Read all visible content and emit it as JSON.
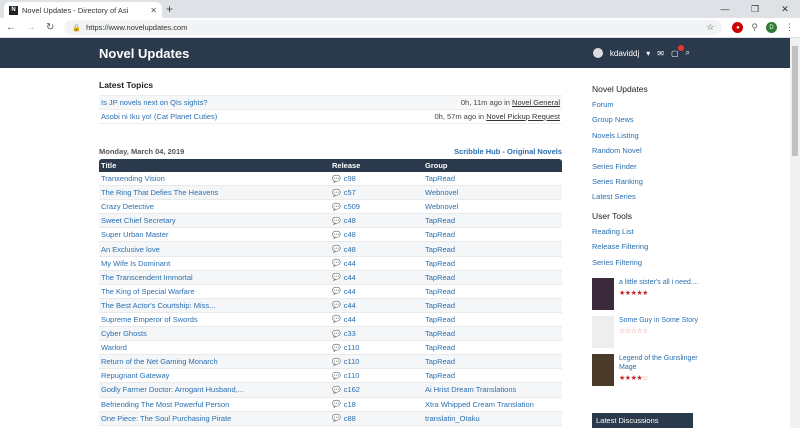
{
  "browser": {
    "tab_title": "Novel Updates - Directory of Asi",
    "url": "https://www.novelupdates.com"
  },
  "site": {
    "brand": "Novel Updates",
    "username": "kdaviddj"
  },
  "latest_topics": {
    "title": "Latest Topics",
    "items": [
      {
        "title": "Is JP novels next on QIs sights?",
        "ago": "0h, 11m ago in",
        "forum": "Novel General"
      },
      {
        "title": "Asobi ni Iku yo! (Cat Planet Cuties)",
        "ago": "0h, 57m ago in",
        "forum": "Novel Pickup Request"
      }
    ]
  },
  "releases": {
    "date": "Monday, March 04, 2019",
    "source": "Scribble Hub - Original Novels",
    "headers": {
      "title": "Title",
      "release": "Release",
      "group": "Group"
    },
    "rows": [
      {
        "title": "Tranxending Vision",
        "release": "c98",
        "group": "TapRead",
        "new": true
      },
      {
        "title": "The Ring That Defies The Heavens",
        "release": "c57",
        "group": "Webnovel",
        "new": false
      },
      {
        "title": "Crazy Detective",
        "release": "c509",
        "group": "Webnovel",
        "new": false
      },
      {
        "title": "Sweet Chief Secretary",
        "release": "c48",
        "group": "TapRead",
        "new": false
      },
      {
        "title": "Super Urban Master",
        "release": "c48",
        "group": "TapRead",
        "new": false
      },
      {
        "title": "An Exclusive love",
        "release": "c48",
        "group": "TapRead",
        "new": false
      },
      {
        "title": "My Wife Is Dominant",
        "release": "c44",
        "group": "TapRead",
        "new": false
      },
      {
        "title": "The Transcendent Immortal",
        "release": "c44",
        "group": "TapRead",
        "new": false
      },
      {
        "title": "The King of Special Warfare",
        "release": "c44",
        "group": "TapRead",
        "new": false
      },
      {
        "title": "The Best Actor's Courtship: Miss...",
        "release": "c44",
        "group": "TapRead",
        "new": false
      },
      {
        "title": "Supreme Emperor of Swords",
        "release": "c44",
        "group": "TapRead",
        "new": false
      },
      {
        "title": "Cyber Ghosts",
        "release": "c33",
        "group": "TapRead",
        "new": false
      },
      {
        "title": "Warlord",
        "release": "c110",
        "group": "TapRead",
        "new": true
      },
      {
        "title": "Return of the Net Gaming Monarch",
        "release": "c110",
        "group": "TapRead",
        "new": true
      },
      {
        "title": "Repugnant Gateway",
        "release": "c110",
        "group": "TapRead",
        "new": false
      },
      {
        "title": "Godly Farmer Doctor: Arrogant Husband,...",
        "release": "c162",
        "group": "Ai Hrist Dream Translations",
        "new": false
      },
      {
        "title": "Befriending The Most Powerful Person",
        "release": "c18",
        "group": "Xtra Whipped Cream Translation",
        "new": false
      },
      {
        "title": "One Piece: The Soul Purchasing Pirate",
        "release": "c88",
        "group": "translatin_Otaku",
        "new": false
      }
    ]
  },
  "sidebar": {
    "title": "Novel Updates",
    "links": [
      "Forum",
      "Group News",
      "Novels Listing",
      "Random Novel",
      "Series Finder",
      "Series Ranking",
      "Latest Series"
    ],
    "tools_title": "User Tools",
    "tools": [
      "Reading List",
      "Release Filtering",
      "Series Filtering"
    ],
    "recommendations": [
      {
        "title": "a little sister's all i need....",
        "rating": 5,
        "cover": "#3a2a3a"
      },
      {
        "title": "Some Guy in Some Story",
        "rating": 0,
        "cover": "#eeeeee"
      },
      {
        "title": "Legend of the Gunslinger Mage",
        "rating": 4,
        "cover": "#4a3a2a"
      }
    ],
    "discussions_title": "Latest Discussions"
  }
}
